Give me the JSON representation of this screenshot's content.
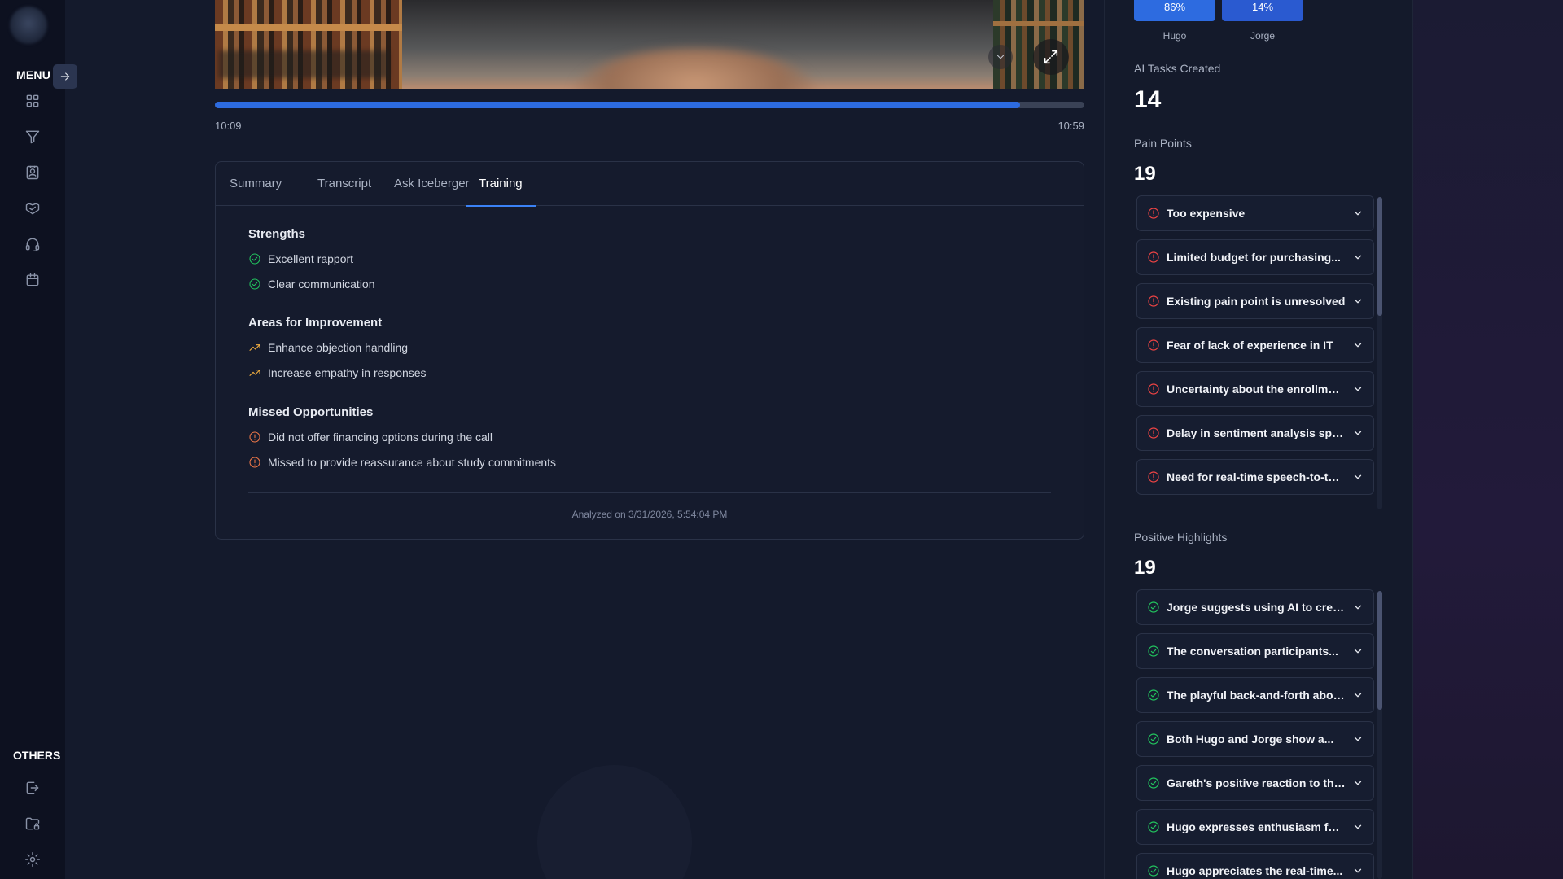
{
  "sidebar": {
    "menu_label": "MENU",
    "others_label": "OTHERS",
    "nav_icons": [
      "grid-icon",
      "filter-icon",
      "contacts-icon",
      "handshake-icon",
      "headset-icon",
      "calendar-icon"
    ],
    "other_icons": [
      "logout-icon",
      "folder-lock-icon",
      "settings-icon"
    ]
  },
  "player": {
    "time_current": "10:09",
    "time_total": "10:59",
    "progress_fraction": 0.926
  },
  "tabs": [
    {
      "label": "Summary",
      "active": false
    },
    {
      "label": "Transcript",
      "active": false
    },
    {
      "label": "Ask Iceberger",
      "active": false
    },
    {
      "label": "Training",
      "active": true
    }
  ],
  "training": {
    "strengths_title": "Strengths",
    "strengths": [
      "Excellent rapport",
      "Clear communication"
    ],
    "improvement_title": "Areas for Improvement",
    "improvements": [
      "Enhance objection handling",
      "Increase empathy in responses"
    ],
    "missed_title": "Missed Opportunities",
    "missed": [
      "Did not offer financing options during the call",
      "Missed to provide reassurance about study commitments"
    ],
    "analyzed": "Analyzed on 3/31/2026, 5:54:04 PM"
  },
  "talk_ratio": [
    {
      "name": "Hugo",
      "percent_label": "86%",
      "value": 86
    },
    {
      "name": "Jorge",
      "percent_label": "14%",
      "value": 14
    }
  ],
  "ai_tasks": {
    "label": "AI Tasks Created",
    "count": "14"
  },
  "pain_points": {
    "label": "Pain Points",
    "count": "19",
    "items": [
      "Too expensive",
      "Limited budget for purchasing...",
      "Existing pain point is unresolved",
      "Fear of lack of experience in IT",
      "Uncertainty about the enrollmen...",
      "Delay in sentiment analysis speed",
      "Need for real-time speech-to-tex..."
    ]
  },
  "positive_highlights": {
    "label": "Positive Highlights",
    "count": "19",
    "items": [
      "Jorge suggests using AI to create...",
      "The conversation participants...",
      "The playful back-and-forth about...",
      "Both Hugo and Jorge show a...",
      "Gareth's positive reaction to the...",
      "Hugo expresses enthusiasm for...",
      "Hugo appreciates the real-time..."
    ]
  },
  "colors": {
    "accent": "#2d6be0",
    "success": "#22c55e",
    "warning": "#f5b041",
    "danger": "#ef4444"
  }
}
